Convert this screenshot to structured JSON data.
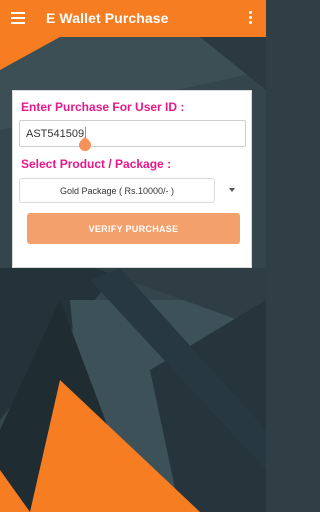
{
  "app_bar": {
    "title": "E Wallet Purchase"
  },
  "form": {
    "user_id_label": "Enter Purchase For User ID :",
    "user_id_value": "AST541509",
    "product_label": "Select Product / Package :",
    "selected_package": "Gold Package ( Rs.10000/- )",
    "verify_button_label": "VERIFY PURCHASE"
  },
  "icons": {
    "menu": "menu-icon",
    "overflow": "more-vert-icon",
    "dropdown": "arrow-drop-down-icon"
  },
  "colors": {
    "accent": "#f77d22",
    "label": "#e6198a",
    "button": "#f4a06c",
    "background_dark": "#2f3f45"
  }
}
